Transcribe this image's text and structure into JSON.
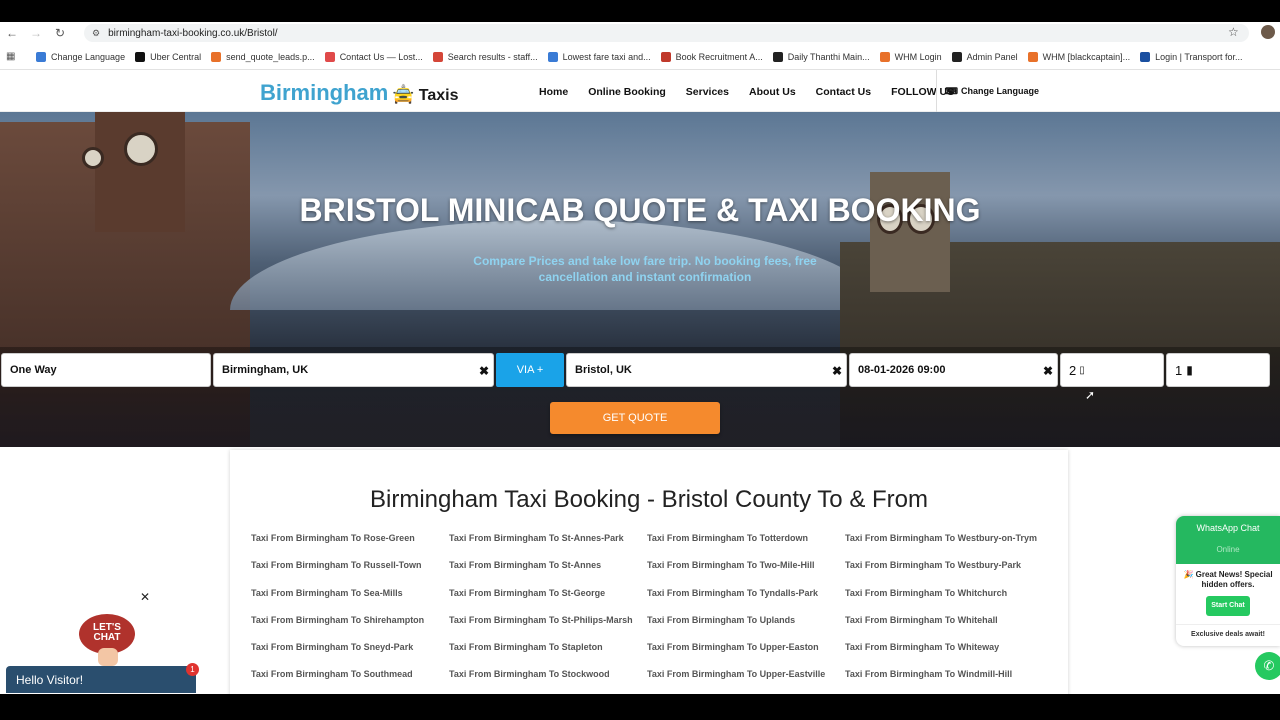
{
  "browser": {
    "url": "birmingham-taxi-booking.co.uk/Bristol/",
    "bookmarks": [
      {
        "label": "Change Language",
        "color": "#3a7bd5"
      },
      {
        "label": "Uber Central",
        "color": "#111111"
      },
      {
        "label": "send_quote_leads.p...",
        "color": "#e8712a"
      },
      {
        "label": "Contact Us — Lost...",
        "color": "#e04a4a"
      },
      {
        "label": "Search results - staff...",
        "color": "#d44638"
      },
      {
        "label": "Lowest fare taxi and...",
        "color": "#3a7bd5"
      },
      {
        "label": "Book Recruitment A...",
        "color": "#c0392b"
      },
      {
        "label": "Daily Thanthi Main...",
        "color": "#222222"
      },
      {
        "label": "WHM Login",
        "color": "#e8712a"
      },
      {
        "label": "Admin Panel",
        "color": "#222222"
      },
      {
        "label": "WHM [blackcaptain]...",
        "color": "#e8712a"
      },
      {
        "label": "Login | Transport for...",
        "color": "#1a4fa0"
      }
    ]
  },
  "site": {
    "logo_main": "Birmingham",
    "logo_sub": "Taxis",
    "nav": [
      "Home",
      "Online Booking",
      "Services",
      "About Us",
      "Contact Us",
      "FOLLOW US"
    ],
    "language": "Change Language"
  },
  "hero": {
    "title": "BRISTOL MINICAB QUOTE & TAXI BOOKING",
    "subtitle": "Compare Prices and take low fare trip. No booking fees, free cancellation and instant confirmation"
  },
  "form": {
    "trip_type": "One Way",
    "from": "Birmingham, UK",
    "via": "VIA +",
    "to": "Bristol, UK",
    "datetime": "08-01-2026 09:00",
    "passengers": "2",
    "luggage": "1",
    "submit": "GET QUOTE"
  },
  "content": {
    "heading": "Birmingham Taxi Booking - Bristol County To & From",
    "links": [
      "Taxi From Birmingham To Rose-Green",
      "Taxi From Birmingham To St-Annes-Park",
      "Taxi From Birmingham To Totterdown",
      "Taxi From Birmingham To Westbury-on-Trym",
      "Taxi From Birmingham To Russell-Town",
      "Taxi From Birmingham To St-Annes",
      "Taxi From Birmingham To Two-Mile-Hill",
      "Taxi From Birmingham To Westbury-Park",
      "Taxi From Birmingham To Sea-Mills",
      "Taxi From Birmingham To St-George",
      "Taxi From Birmingham To Tyndalls-Park",
      "Taxi From Birmingham To Whitchurch",
      "Taxi From Birmingham To Shirehampton",
      "Taxi From Birmingham To St-Philips-Marsh",
      "Taxi From Birmingham To Uplands",
      "Taxi From Birmingham To Whitehall",
      "Taxi From Birmingham To Sneyd-Park",
      "Taxi From Birmingham To Stapleton",
      "Taxi From Birmingham To Upper-Easton",
      "Taxi From Birmingham To Whiteway",
      "Taxi From Birmingham To Southmead",
      "Taxi From Birmingham To Stockwood",
      "Taxi From Birmingham To Upper-Eastville",
      "Taxi From Birmingham To Windmill-Hill"
    ]
  },
  "chat": {
    "bubble": "LET'S CHAT",
    "hello": "Hello Visitor!",
    "badge": "1"
  },
  "whatsapp": {
    "title": "WhatsApp Chat",
    "status": "Online",
    "news": "🎉 Great News! Special hidden offers.",
    "button": "Start Chat",
    "footer": "Exclusive deals await!"
  }
}
